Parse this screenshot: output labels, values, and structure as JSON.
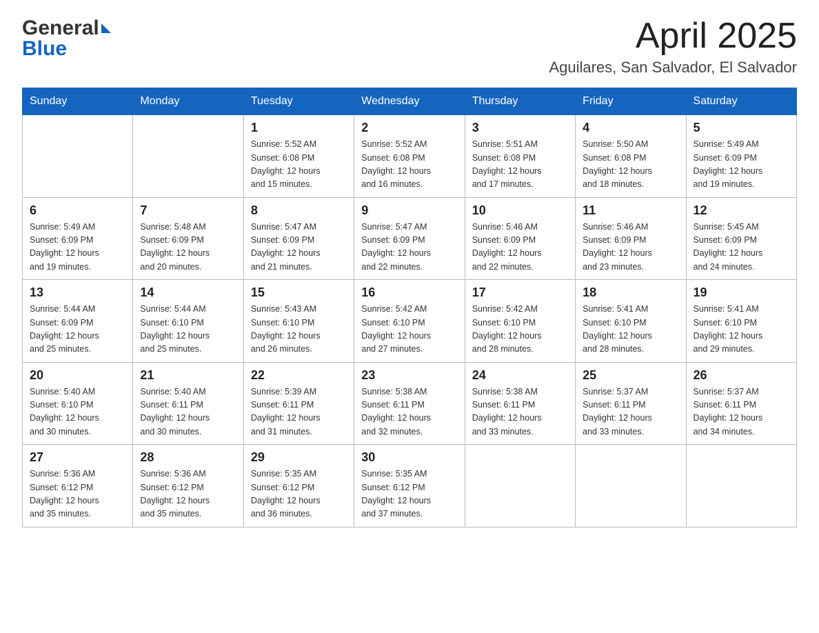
{
  "header": {
    "logo_general": "General",
    "logo_blue": "Blue",
    "month_title": "April 2025",
    "location": "Aguilares, San Salvador, El Salvador"
  },
  "calendar": {
    "days_of_week": [
      "Sunday",
      "Monday",
      "Tuesday",
      "Wednesday",
      "Thursday",
      "Friday",
      "Saturday"
    ],
    "weeks": [
      [
        {
          "day": "",
          "info": ""
        },
        {
          "day": "",
          "info": ""
        },
        {
          "day": "1",
          "info": "Sunrise: 5:52 AM\nSunset: 6:08 PM\nDaylight: 12 hours\nand 15 minutes."
        },
        {
          "day": "2",
          "info": "Sunrise: 5:52 AM\nSunset: 6:08 PM\nDaylight: 12 hours\nand 16 minutes."
        },
        {
          "day": "3",
          "info": "Sunrise: 5:51 AM\nSunset: 6:08 PM\nDaylight: 12 hours\nand 17 minutes."
        },
        {
          "day": "4",
          "info": "Sunrise: 5:50 AM\nSunset: 6:08 PM\nDaylight: 12 hours\nand 18 minutes."
        },
        {
          "day": "5",
          "info": "Sunrise: 5:49 AM\nSunset: 6:09 PM\nDaylight: 12 hours\nand 19 minutes."
        }
      ],
      [
        {
          "day": "6",
          "info": "Sunrise: 5:49 AM\nSunset: 6:09 PM\nDaylight: 12 hours\nand 19 minutes."
        },
        {
          "day": "7",
          "info": "Sunrise: 5:48 AM\nSunset: 6:09 PM\nDaylight: 12 hours\nand 20 minutes."
        },
        {
          "day": "8",
          "info": "Sunrise: 5:47 AM\nSunset: 6:09 PM\nDaylight: 12 hours\nand 21 minutes."
        },
        {
          "day": "9",
          "info": "Sunrise: 5:47 AM\nSunset: 6:09 PM\nDaylight: 12 hours\nand 22 minutes."
        },
        {
          "day": "10",
          "info": "Sunrise: 5:46 AM\nSunset: 6:09 PM\nDaylight: 12 hours\nand 22 minutes."
        },
        {
          "day": "11",
          "info": "Sunrise: 5:46 AM\nSunset: 6:09 PM\nDaylight: 12 hours\nand 23 minutes."
        },
        {
          "day": "12",
          "info": "Sunrise: 5:45 AM\nSunset: 6:09 PM\nDaylight: 12 hours\nand 24 minutes."
        }
      ],
      [
        {
          "day": "13",
          "info": "Sunrise: 5:44 AM\nSunset: 6:09 PM\nDaylight: 12 hours\nand 25 minutes."
        },
        {
          "day": "14",
          "info": "Sunrise: 5:44 AM\nSunset: 6:10 PM\nDaylight: 12 hours\nand 25 minutes."
        },
        {
          "day": "15",
          "info": "Sunrise: 5:43 AM\nSunset: 6:10 PM\nDaylight: 12 hours\nand 26 minutes."
        },
        {
          "day": "16",
          "info": "Sunrise: 5:42 AM\nSunset: 6:10 PM\nDaylight: 12 hours\nand 27 minutes."
        },
        {
          "day": "17",
          "info": "Sunrise: 5:42 AM\nSunset: 6:10 PM\nDaylight: 12 hours\nand 28 minutes."
        },
        {
          "day": "18",
          "info": "Sunrise: 5:41 AM\nSunset: 6:10 PM\nDaylight: 12 hours\nand 28 minutes."
        },
        {
          "day": "19",
          "info": "Sunrise: 5:41 AM\nSunset: 6:10 PM\nDaylight: 12 hours\nand 29 minutes."
        }
      ],
      [
        {
          "day": "20",
          "info": "Sunrise: 5:40 AM\nSunset: 6:10 PM\nDaylight: 12 hours\nand 30 minutes."
        },
        {
          "day": "21",
          "info": "Sunrise: 5:40 AM\nSunset: 6:11 PM\nDaylight: 12 hours\nand 30 minutes."
        },
        {
          "day": "22",
          "info": "Sunrise: 5:39 AM\nSunset: 6:11 PM\nDaylight: 12 hours\nand 31 minutes."
        },
        {
          "day": "23",
          "info": "Sunrise: 5:38 AM\nSunset: 6:11 PM\nDaylight: 12 hours\nand 32 minutes."
        },
        {
          "day": "24",
          "info": "Sunrise: 5:38 AM\nSunset: 6:11 PM\nDaylight: 12 hours\nand 33 minutes."
        },
        {
          "day": "25",
          "info": "Sunrise: 5:37 AM\nSunset: 6:11 PM\nDaylight: 12 hours\nand 33 minutes."
        },
        {
          "day": "26",
          "info": "Sunrise: 5:37 AM\nSunset: 6:11 PM\nDaylight: 12 hours\nand 34 minutes."
        }
      ],
      [
        {
          "day": "27",
          "info": "Sunrise: 5:36 AM\nSunset: 6:12 PM\nDaylight: 12 hours\nand 35 minutes."
        },
        {
          "day": "28",
          "info": "Sunrise: 5:36 AM\nSunset: 6:12 PM\nDaylight: 12 hours\nand 35 minutes."
        },
        {
          "day": "29",
          "info": "Sunrise: 5:35 AM\nSunset: 6:12 PM\nDaylight: 12 hours\nand 36 minutes."
        },
        {
          "day": "30",
          "info": "Sunrise: 5:35 AM\nSunset: 6:12 PM\nDaylight: 12 hours\nand 37 minutes."
        },
        {
          "day": "",
          "info": ""
        },
        {
          "day": "",
          "info": ""
        },
        {
          "day": "",
          "info": ""
        }
      ]
    ]
  }
}
